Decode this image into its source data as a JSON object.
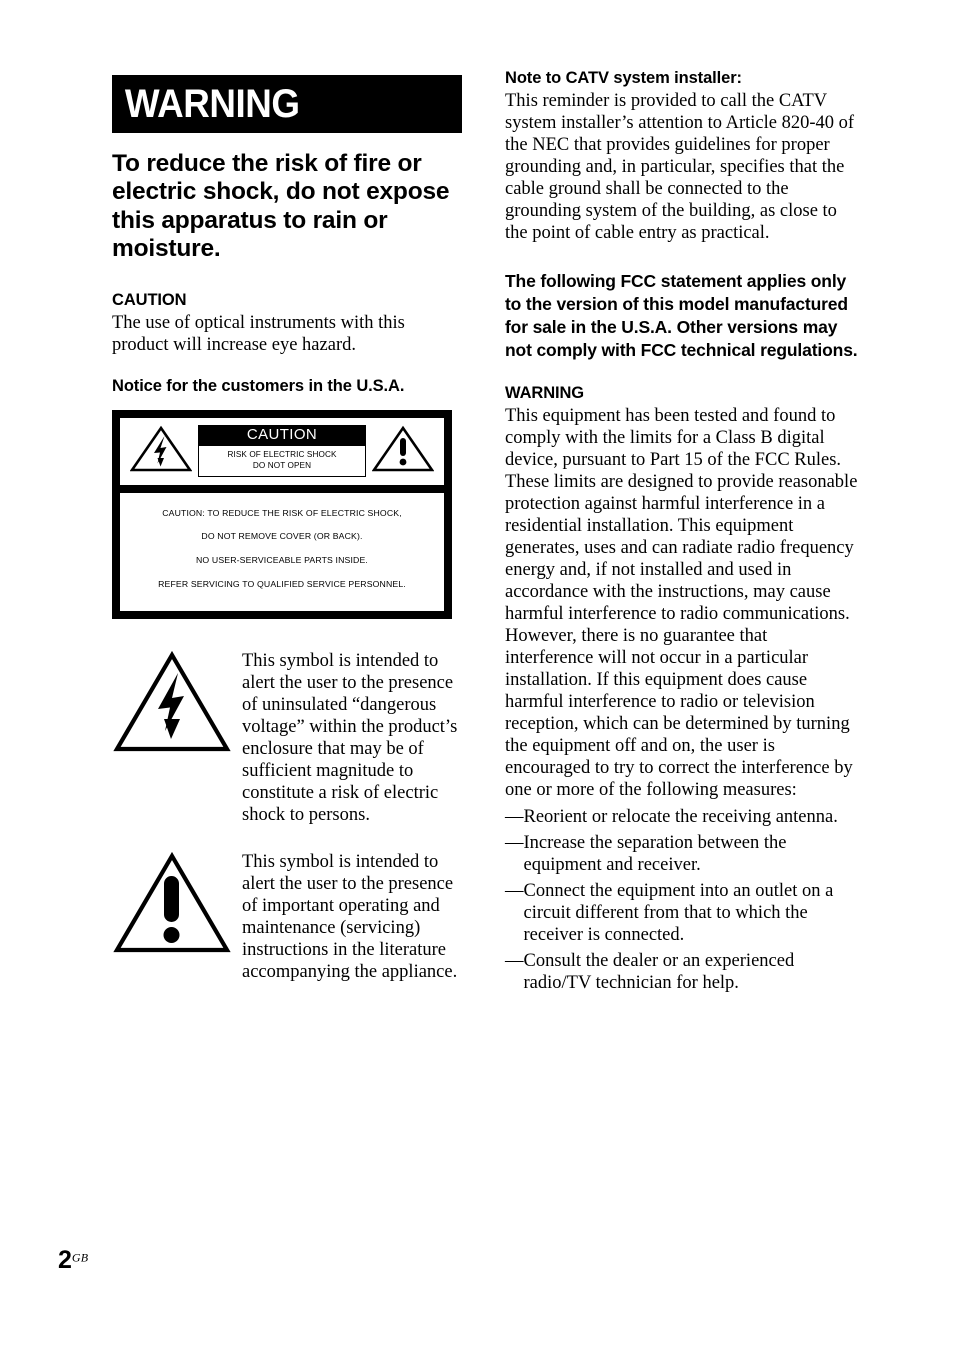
{
  "page": {
    "number": "2",
    "region_code": "GB"
  },
  "left_column": {
    "banner": {
      "label": "WARNING"
    },
    "main_warning": "To reduce the risk of fire or electric shock, do not expose this apparatus to rain or moisture.",
    "caution_heading": "CAUTION",
    "caution_body": "The use of optical instruments with this product will increase eye hazard.",
    "notice_heading": "Notice for the customers in the U.S.A.",
    "caution_label": {
      "title": "CAUTION",
      "subtitle_line1": "RISK OF ELECTRIC SHOCK",
      "subtitle_line2": "DO NOT OPEN",
      "lines": [
        "CAUTION: TO REDUCE THE RISK OF ELECTRIC SHOCK,",
        "DO NOT REMOVE COVER (OR BACK).",
        "NO USER-SERVICEABLE PARTS INSIDE.",
        "REFER SERVICING TO QUALIFIED SERVICE PERSONNEL."
      ]
    },
    "symbols": [
      {
        "icon": "lightning-bolt-triangle-icon",
        "text": "This symbol is intended to alert the user to the presence of uninsulated “dangerous voltage” within the product’s enclosure that may be of sufficient magnitude to constitute a risk of electric shock to persons."
      },
      {
        "icon": "exclamation-triangle-icon",
        "text": "This symbol is intended to alert the user to the presence of important operating and maintenance (servicing) instructions in the literature accompanying the appliance."
      }
    ]
  },
  "right_column": {
    "catv_heading": "Note to CATV system installer:",
    "catv_body": "This reminder is provided to call the CATV system installer’s attention to Article 820-40 of the NEC that provides guidelines for proper grounding and, in particular, specifies that the cable ground shall be connected to the grounding system of the building, as close to the point of cable entry as practical.",
    "fcc_applies_heading": "The following FCC statement applies only to the version of this model manufactured for sale in the U.S.A. Other versions may not comply with FCC technical regulations.",
    "warning_heading": "WARNING",
    "warning_body": "This equipment has been tested and found to comply with the limits for a Class B digital device, pursuant to Part 15 of the FCC Rules. These limits are designed to provide reasonable protection against harmful interference in a residential installation. This equipment generates, uses and can radiate radio frequency energy and, if not installed and used in accordance with the instructions, may cause harmful interference to radio communications. However, there is no guarantee that interference will not occur in a particular installation. If this equipment does cause harmful interference to radio or television reception, which can be determined by turning the equipment off and on, the user is encouraged to try to correct the interference by one or more of the following measures:",
    "measure_dash": "—",
    "measures": [
      "Reorient or relocate the receiving antenna.",
      "Increase the separation between the equipment and receiver.",
      "Connect the equipment into an outlet on a circuit different from that to which the receiver is connected.",
      "Consult the dealer or an experienced radio/TV technician for help."
    ]
  },
  "colors": {
    "ink": "#000000",
    "paper": "#ffffff"
  }
}
